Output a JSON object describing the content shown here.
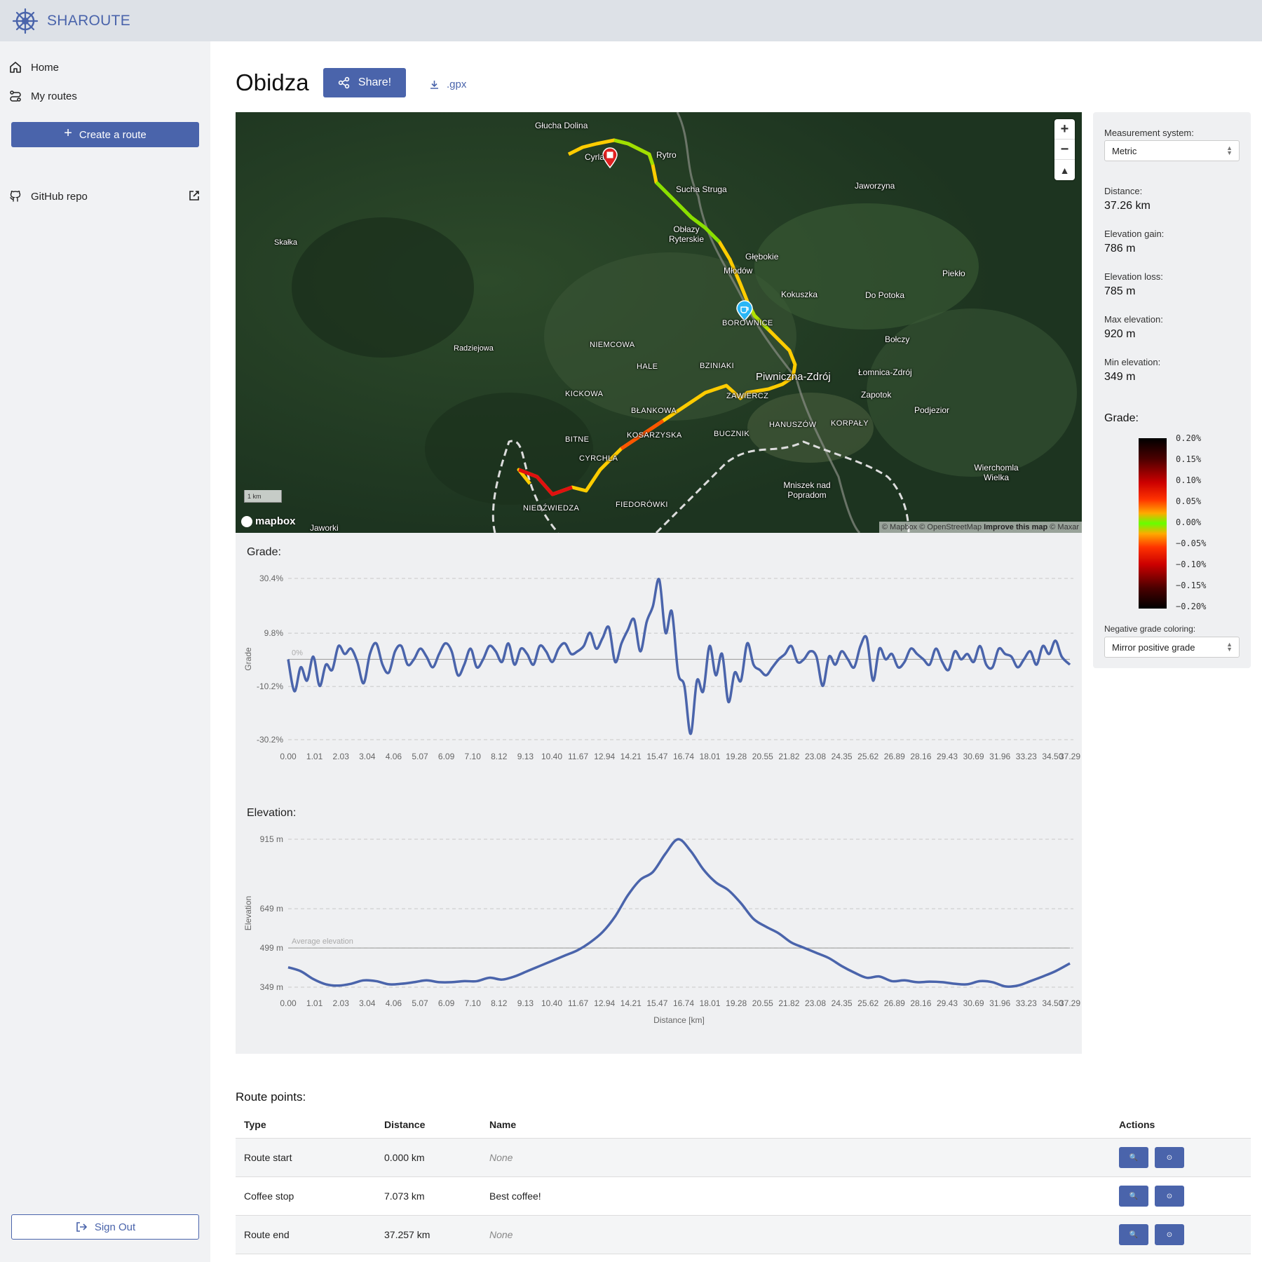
{
  "app": {
    "brand": "SHAROUTE",
    "logo_icon": "ship-wheel-icon"
  },
  "sidebar": {
    "items": [
      {
        "label": "Home",
        "icon": "home-icon"
      },
      {
        "label": "My routes",
        "icon": "route-icon"
      }
    ],
    "create_label": "Create a route",
    "github_label": "GitHub repo",
    "signout_label": "Sign Out"
  },
  "header": {
    "title": "Obidza",
    "share_label": "Share!",
    "download_label": ".gpx"
  },
  "map": {
    "labels": [
      "Głucha Dolina",
      "Cyrla",
      "Rytro",
      "Sucha Struga",
      "Jaworzyna",
      "Skałka",
      "Obłazy Ryterskie",
      "Głębokie",
      "Młodów",
      "Piekło",
      "Kokuszka",
      "Do Potoka",
      "BOROWNICE",
      "Radziejowa",
      "NIEMCOWA",
      "Bołczy",
      "HALE",
      "BZINIAKI",
      "Piwniczna-Zdrój",
      "Łomnica-Zdrój",
      "KICKOWA",
      "Zapotok",
      "BŁANKOWA",
      "ZAWIERCZ",
      "Podjezior",
      "HANUSZÓW",
      "KORPAŁY",
      "BITNE",
      "KOSARZYSKA",
      "BUCZNIK",
      "CYRCHLA",
      "Wierchomla Wielka",
      "Mniszek nad Popradom",
      "NIEDŹWIEDZA",
      "FIEDORÓWKI",
      "Jaworki"
    ],
    "scale": "1 km",
    "logo": "mapbox",
    "attribution_1": "© Mapbox © OpenStreetMap",
    "attribution_2": "Improve this map",
    "attribution_3": "© Maxar"
  },
  "settings": {
    "measurement_label": "Measurement system:",
    "measurement_value": "Metric",
    "distance_label": "Distance:",
    "distance_value": "37.26 km",
    "gain_label": "Elevation gain:",
    "gain_value": "786 m",
    "loss_label": "Elevation loss:",
    "loss_value": "785 m",
    "max_label": "Max elevation:",
    "max_value": "920 m",
    "min_label": "Min elevation:",
    "min_value": "349 m",
    "grade_label": "Grade:",
    "grade_ticks": [
      "0.20%",
      "0.15%",
      "0.10%",
      "0.05%",
      "0.00%",
      "−0.05%",
      "−0.10%",
      "−0.15%",
      "−0.20%"
    ],
    "negative_label": "Negative grade coloring:",
    "negative_value": "Mirror positive grade"
  },
  "chart_data": [
    {
      "type": "line",
      "title": "Grade:",
      "xlabel": "Distance [km]",
      "ylabel": "Grade",
      "y_ticks": [
        "30.4%",
        "9.8%",
        "0%",
        "-10.2%",
        "-30.2%"
      ],
      "ylim": [
        -30.2,
        30.4
      ],
      "x_ticks": [
        "0.00",
        "1.01",
        "2.03",
        "3.04",
        "4.06",
        "5.07",
        "6.09",
        "7.10",
        "8.12",
        "9.13",
        "10.40",
        "11.67",
        "12.94",
        "14.21",
        "15.47",
        "16.74",
        "18.01",
        "19.28",
        "20.55",
        "21.82",
        "23.08",
        "24.35",
        "25.62",
        "26.89",
        "28.16",
        "29.43",
        "30.69",
        "31.96",
        "33.23",
        "34.50",
        "37.29"
      ],
      "x": [
        0.0,
        0.3,
        0.6,
        0.9,
        1.2,
        1.5,
        1.8,
        2.1,
        2.4,
        2.7,
        3.0,
        3.3,
        3.6,
        3.9,
        4.2,
        4.5,
        4.8,
        5.1,
        5.4,
        5.7,
        6.0,
        6.3,
        6.6,
        6.9,
        7.2,
        7.5,
        7.8,
        8.1,
        8.4,
        8.7,
        9.0,
        9.3,
        9.6,
        9.9,
        10.2,
        10.5,
        10.8,
        11.1,
        11.4,
        11.7,
        12.0,
        12.3,
        12.6,
        12.9,
        13.2,
        13.5,
        13.8,
        14.1,
        14.4,
        14.7,
        15.0,
        15.3,
        15.6,
        15.9,
        16.2,
        16.5,
        16.8,
        17.1,
        17.4,
        17.7,
        18.0,
        18.3,
        18.6,
        18.9,
        19.2,
        19.5,
        19.8,
        20.1,
        20.4,
        20.7,
        21.0,
        21.3,
        21.6,
        21.9,
        22.2,
        22.5,
        22.8,
        23.1,
        23.4,
        23.7,
        24.0,
        24.3,
        24.6,
        24.9,
        25.2,
        25.5,
        25.8,
        26.1,
        26.4,
        26.7,
        27.0,
        27.3,
        27.6,
        27.9,
        28.2,
        28.5,
        28.8,
        29.1,
        29.4,
        29.7,
        30.0,
        30.3,
        30.6,
        30.9,
        31.2,
        31.5,
        31.8,
        32.1,
        32.4,
        32.7,
        33.0,
        33.3,
        33.6,
        33.9,
        34.2,
        34.5,
        34.8,
        35.1,
        35.4,
        35.7,
        36.0,
        36.3,
        36.6,
        36.9,
        37.29
      ],
      "values": [
        0,
        -12,
        -3,
        -8,
        1,
        -10,
        -2,
        -4,
        5,
        2,
        4,
        -1,
        -9,
        2,
        6,
        -2,
        -5,
        3,
        5,
        -2,
        0,
        4,
        1,
        -3,
        2,
        6,
        3,
        -6,
        -2,
        4,
        -3,
        0,
        5,
        3,
        -1,
        6,
        -2,
        4,
        2,
        -2,
        5,
        3,
        -1,
        4,
        6,
        2,
        3,
        5,
        10,
        4,
        8,
        12,
        -1,
        6,
        11,
        15,
        3,
        14,
        20,
        30,
        10,
        18,
        -5,
        -10,
        -28,
        -8,
        -12,
        5,
        -6,
        2,
        -16,
        -5,
        -8,
        6,
        -2,
        -4,
        -6,
        -3,
        0,
        2,
        5,
        -1,
        0,
        3,
        1,
        -10,
        1,
        -2,
        3,
        0,
        -3,
        5,
        8,
        -8,
        4,
        0,
        2,
        -3,
        -1,
        4,
        2,
        0,
        -2,
        4,
        -1,
        -4,
        3,
        0,
        2,
        -1,
        5,
        -2,
        -3,
        4,
        2,
        1,
        -3,
        0,
        3,
        -2,
        5,
        2,
        7,
        1,
        -2,
        5,
        4,
        0
      ],
      "reference_line": {
        "y": 0,
        "label": "0%"
      }
    },
    {
      "type": "line",
      "title": "Elevation:",
      "xlabel": "Distance [km]",
      "ylabel": "Elevation",
      "y_ticks": [
        "915 m",
        "649 m",
        "499 m",
        "349 m"
      ],
      "ylim": [
        349,
        915
      ],
      "x_ticks": [
        "0.00",
        "1.01",
        "2.03",
        "3.04",
        "4.06",
        "5.07",
        "6.09",
        "7.10",
        "8.12",
        "9.13",
        "10.40",
        "11.67",
        "12.94",
        "14.21",
        "15.47",
        "16.74",
        "18.01",
        "19.28",
        "20.55",
        "21.82",
        "23.08",
        "24.35",
        "25.62",
        "26.89",
        "28.16",
        "29.43",
        "30.69",
        "31.96",
        "33.23",
        "34.50",
        "37.29"
      ],
      "x": [
        0.0,
        0.6,
        1.2,
        1.8,
        2.4,
        3.0,
        3.6,
        4.2,
        4.8,
        5.4,
        6.0,
        6.6,
        7.2,
        7.8,
        8.4,
        9.0,
        9.6,
        10.2,
        10.8,
        11.4,
        12.0,
        12.6,
        13.2,
        13.8,
        14.4,
        15.0,
        15.6,
        16.2,
        16.8,
        17.4,
        18.0,
        18.6,
        19.2,
        19.8,
        20.4,
        21.0,
        21.6,
        22.2,
        22.8,
        23.4,
        24.0,
        24.6,
        25.2,
        25.8,
        26.4,
        27.0,
        27.6,
        28.2,
        28.8,
        29.4,
        30.0,
        30.6,
        31.2,
        31.8,
        32.4,
        33.0,
        33.6,
        34.2,
        34.8,
        35.4,
        36.0,
        36.6,
        37.29
      ],
      "values": [
        425,
        410,
        380,
        360,
        355,
        362,
        375,
        372,
        360,
        362,
        368,
        375,
        368,
        368,
        372,
        372,
        385,
        378,
        390,
        410,
        430,
        450,
        470,
        490,
        520,
        560,
        620,
        700,
        760,
        790,
        860,
        915,
        870,
        800,
        750,
        720,
        670,
        610,
        580,
        555,
        520,
        500,
        480,
        460,
        430,
        405,
        385,
        390,
        372,
        375,
        368,
        370,
        368,
        362,
        360,
        372,
        368,
        352,
        355,
        372,
        390,
        410,
        440
      ],
      "reference_line": {
        "y": 499,
        "label": "Average elevation"
      }
    }
  ],
  "route_points": {
    "title": "Route points:",
    "headers": {
      "type": "Type",
      "distance": "Distance",
      "name": "Name",
      "actions": "Actions"
    },
    "rows": [
      {
        "type": "Route start",
        "distance": "0.000 km",
        "name": "None"
      },
      {
        "type": "Coffee stop",
        "distance": "7.073 km",
        "name": "Best coffee!"
      },
      {
        "type": "Route end",
        "distance": "37.257 km",
        "name": "None"
      }
    ],
    "action_icons": [
      "zoom-icon",
      "locate-icon"
    ]
  }
}
